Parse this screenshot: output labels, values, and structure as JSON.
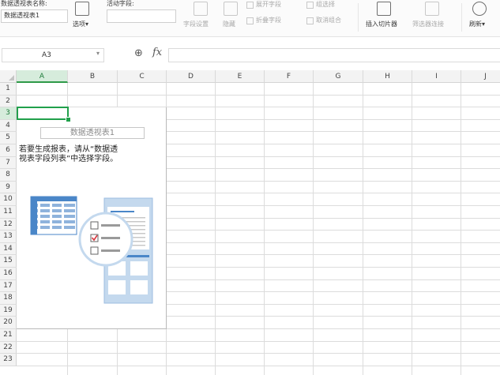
{
  "ribbon": {
    "pivot_name_label": "数据透视表名称:",
    "pivot_name_value": "数据透视表1",
    "options_label": "选项",
    "active_field_label": "活动字段:",
    "field_settings_label": "字段设置",
    "hide_label": "隐藏",
    "expand_field_label": "展开字段",
    "collapse_field_label": "折叠字段",
    "group_selection_label": "组选择",
    "ungroup_label": "取消组合",
    "insert_slicer_label": "插入切片器",
    "filter_connections_label": "筛选器连接",
    "refresh_label": "刷新",
    "dropdown_arrow": "▾"
  },
  "formula_bar": {
    "name_box_value": "A3",
    "name_box_arrow": "▾",
    "zoom_icon_glyph": "⊕",
    "fx_label": "fx",
    "formula_value": ""
  },
  "grid": {
    "columns": [
      "A",
      "B",
      "C",
      "D",
      "E",
      "F",
      "G",
      "H",
      "I",
      "J"
    ],
    "rows": [
      "1",
      "2",
      "3",
      "4",
      "5",
      "6",
      "7",
      "8",
      "9",
      "10",
      "11",
      "12",
      "13",
      "14",
      "15",
      "16",
      "17",
      "18",
      "19",
      "20",
      "21",
      "22",
      "23"
    ],
    "active_column": "A",
    "active_row": "3"
  },
  "pivot": {
    "title": "数据透视表1",
    "instruction_line1": "若要生成报表，请从“数据透",
    "instruction_line2": "视表字段列表”中选择字段。"
  },
  "colors": {
    "accent_green": "#21a04b",
    "illustration_blue": "#4a86c8",
    "illustration_light_blue": "#c4d9ee",
    "check_red": "#d9363e"
  }
}
